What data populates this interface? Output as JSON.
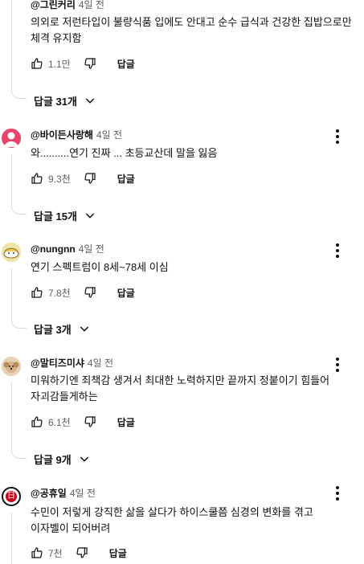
{
  "comments": [
    {
      "author": "@그린커리",
      "time": "4일 전",
      "text": "의외로 저런타입이 불량식품 입에도 안대고 순수 급식과 건강한 집밥으로만 체격 유지함",
      "likes": "1.1만",
      "reply_label": "답글",
      "replies_label": "답글 31개"
    },
    {
      "author": "@바이든사랑해",
      "time": "4일 전",
      "text": "와..........연기 진짜 ... 초등교산데 말을 잃음",
      "likes": "9.3천",
      "reply_label": "답글",
      "replies_label": "답글 15개",
      "avatar_color": "#e8436b"
    },
    {
      "author": "@nungnn",
      "time": "4일 전",
      "text": "연기 스펙트럼이 8세~78세 이심",
      "likes": "7.8천",
      "reply_label": "답글",
      "replies_label": "답글 3개"
    },
    {
      "author": "@말티즈미샤",
      "time": "4일 전",
      "text": "미워하기엔 죄책감 생겨서 최대한 노력하지만 끝까지 정붙이기 힘들어 자괴감들게하는",
      "likes": "6.1천",
      "reply_label": "답글",
      "replies_label": "답글 9개"
    },
    {
      "author": "@공휴일",
      "time": "4일 전",
      "text": "수민이 저렇게 강직한 삶을 살다가 하이스쿨쯤 심경의 변화를 겪고 이자벨이 되어버려",
      "likes": "7천",
      "reply_label": "답글",
      "avatar_glyph": "日",
      "avatar_color": "#d0021b"
    }
  ],
  "icons": {
    "like": "thumbs-up-icon",
    "dislike": "thumbs-down-icon",
    "more": "more-vertical-icon",
    "expand": "chevron-down-icon"
  }
}
